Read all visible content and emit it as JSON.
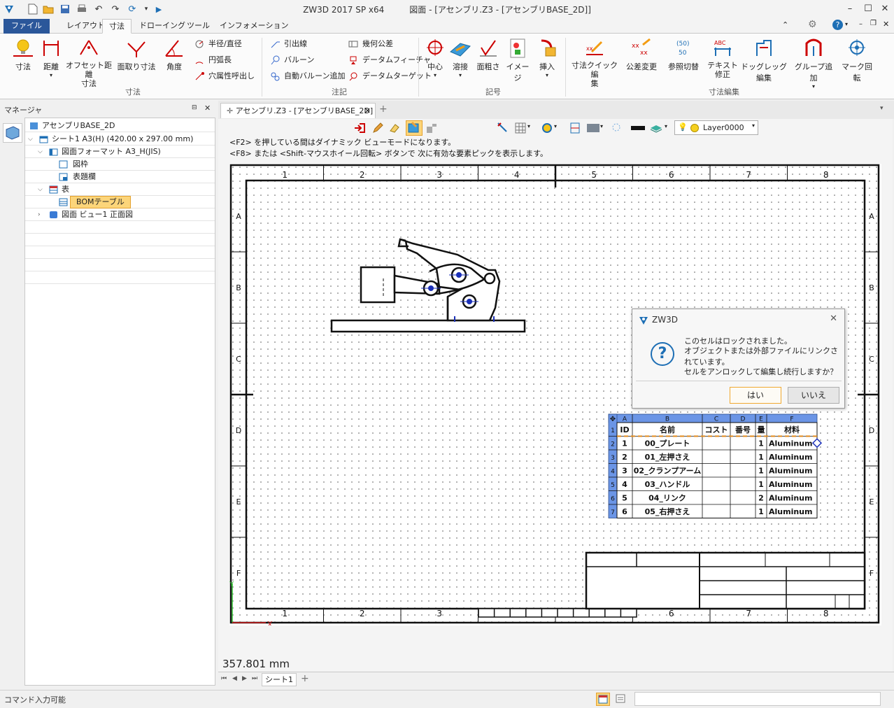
{
  "window": {
    "title": "ZW3D 2017 SP x64",
    "doc_title": "図面 - [アセンブリ.Z3 - [アセンブリBASE_2D]]"
  },
  "ribbon_tabs": [
    "ファイル(F)",
    "レイアウト",
    "寸法",
    "ドローイング",
    "ツール",
    "インフォメーション"
  ],
  "ribbon": {
    "dim_group": {
      "label": "寸法",
      "buttons": [
        "寸法",
        "距離",
        "オフセット距離\n寸法",
        "面取り寸法",
        "角度"
      ],
      "small": [
        "半径/直径",
        "円弧長",
        "穴属性呼出し"
      ]
    },
    "note_group": {
      "label": "注記",
      "small_left": [
        "引出線",
        "バルーン",
        "自動バルーン追加"
      ],
      "small_right": [
        "幾何公差",
        "データムフィーチャ",
        "データムターゲット"
      ]
    },
    "symbol_group": {
      "label": "記号",
      "buttons": [
        "中心",
        "溶接",
        "面粗さ",
        "イメージ",
        "挿入"
      ]
    },
    "edit_group": {
      "label": "寸法編集",
      "buttons": [
        "寸法クイック編\n集",
        "公差変更",
        "参照切替",
        "テキスト\n修正",
        "ドッグレッグ編集",
        "グループ追加",
        "マーク回転"
      ]
    }
  },
  "manager": {
    "title": "マネージャ",
    "tree": [
      {
        "label": "アセンブリBASE_2D",
        "level": 0,
        "icon": "drawing-icon"
      },
      {
        "label": "シート1 A3(H) (420.00 x 297.00 mm)",
        "level": 1,
        "icon": "sheet-icon"
      },
      {
        "label": "図面フォーマット A3_H(JIS)",
        "level": 2,
        "icon": "format-icon"
      },
      {
        "label": "図枠",
        "level": 3,
        "icon": "frame-icon"
      },
      {
        "label": "表題欄",
        "level": 3,
        "icon": "titleblock-icon"
      },
      {
        "label": "表",
        "level": 2,
        "icon": "table-icon"
      },
      {
        "label": "BOMテーブル",
        "level": 3,
        "icon": "bom-icon",
        "selected": true
      },
      {
        "label": "図面 ビュー1 正面図",
        "level": 2,
        "icon": "view-icon"
      }
    ]
  },
  "doc_tab": "アセンブリ.Z3 - [アセンブリBASE_2D]",
  "context_toolbar": {
    "layer": "Layer0000"
  },
  "hints": [
    "<F2> を押している間はダイナミック ビューモードになります。",
    "<F8> または <Shift-マウスホイール回転> ボタンで 次に有効な要素ピックを表示します。"
  ],
  "sheet": {
    "col_labels": [
      "1",
      "2",
      "3",
      "4",
      "5",
      "6",
      "7",
      "8"
    ],
    "row_labels": [
      "A",
      "B",
      "C",
      "D",
      "E",
      "F"
    ]
  },
  "bom": {
    "col_letters": [
      "A",
      "B",
      "C",
      "D",
      "E",
      "F"
    ],
    "row_numbers": [
      "1",
      "2",
      "3",
      "4",
      "5",
      "6",
      "7"
    ],
    "header": [
      "ID",
      "名前",
      "コスト",
      "番号",
      "量",
      "材料"
    ],
    "rows": [
      [
        "1",
        "00_プレート",
        "",
        "",
        "1",
        "Aluminum"
      ],
      [
        "2",
        "01_左押さえ",
        "",
        "",
        "1",
        "Aluminum"
      ],
      [
        "3",
        "02_クランプアーム",
        "",
        "",
        "1",
        "Aluminum"
      ],
      [
        "4",
        "03_ハンドル",
        "",
        "",
        "1",
        "Aluminum"
      ],
      [
        "5",
        "04_リンク",
        "",
        "",
        "2",
        "Aluminum"
      ],
      [
        "6",
        "05_右押さえ",
        "",
        "",
        "1",
        "Aluminum"
      ]
    ]
  },
  "dialog": {
    "title": "ZW3D",
    "message": [
      "このセルはロックされました。",
      "オブジェクトまたは外部ファイルにリンクされています。",
      "セルをアンロックして編集し続行しますか？"
    ],
    "yes": "はい",
    "no": "いいえ"
  },
  "measure": "357.801 mm",
  "sheet_tab": "シート1",
  "status": "コマンド入力可能",
  "colors": {
    "file_tab": "#2b579a",
    "bom_header": "#6b95e6",
    "selection": "#fcd57a"
  }
}
